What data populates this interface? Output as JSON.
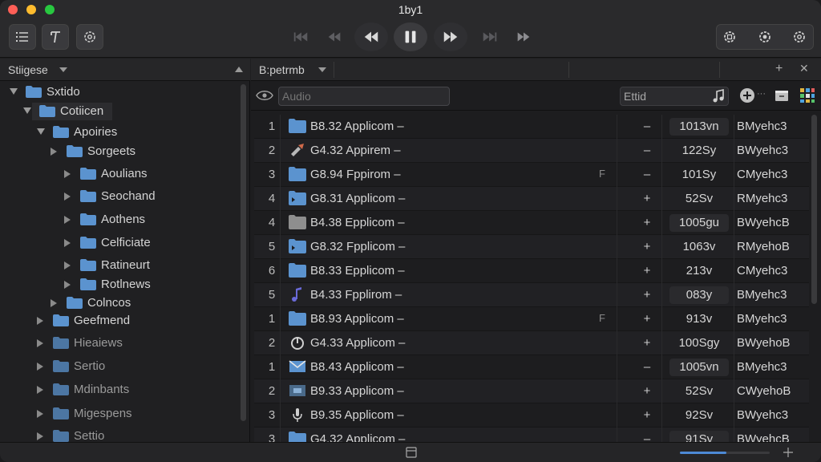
{
  "window": {
    "title": "1by1"
  },
  "toolbar": {
    "left_buttons": [
      "list-icon",
      "text-style-icon",
      "settings-icon"
    ],
    "media_buttons": [
      "skip-back-icon",
      "rewind-icon",
      "previous-icon",
      "pause-icon",
      "next-icon",
      "skip-forward-icon",
      "fast-forward-icon"
    ],
    "right_buttons": [
      "gear-icon",
      "gear-icon",
      "gear-icon"
    ]
  },
  "sidebar": {
    "title": "Stiigese",
    "tree": [
      {
        "label": "Sxtido",
        "depth": 0,
        "state": "open",
        "selected": false
      },
      {
        "label": "Cotiicen",
        "depth": 1,
        "state": "open",
        "selected": true
      },
      {
        "label": "Apoiries",
        "depth": 2,
        "state": "open",
        "selected": false
      },
      {
        "label": "Sorgeets",
        "depth": 3,
        "state": "closed",
        "selected": false
      },
      {
        "label": "Aoulians",
        "depth": 4,
        "state": "closed",
        "selected": false
      },
      {
        "label": "Seochand",
        "depth": 4,
        "state": "closed",
        "selected": false
      },
      {
        "label": "Aothens",
        "depth": 4,
        "state": "closed",
        "selected": false
      },
      {
        "label": "Celficiate",
        "depth": 4,
        "state": "closed",
        "selected": false
      },
      {
        "label": "Ratineurt",
        "depth": 4,
        "state": "closed",
        "selected": false
      },
      {
        "label": "Rotlnews",
        "depth": 4,
        "state": "closed",
        "selected": false
      },
      {
        "label": "Colncos",
        "depth": 3,
        "state": "closed",
        "selected": false
      },
      {
        "label": "Geefmend",
        "depth": 2,
        "state": "closed",
        "selected": false
      },
      {
        "label": "Hieaiews",
        "depth": 2,
        "state": "closed",
        "selected": false
      },
      {
        "label": "Sertio",
        "depth": 2,
        "state": "closed",
        "selected": false
      },
      {
        "label": "Mdinbants",
        "depth": 2,
        "state": "closed",
        "selected": false
      },
      {
        "label": "Migespens",
        "depth": 2,
        "state": "closed",
        "selected": false
      },
      {
        "label": "Settio",
        "depth": 2,
        "state": "closed",
        "selected": false
      }
    ]
  },
  "main": {
    "tab_label": "B:petrmb",
    "filter": {
      "value": "",
      "placeholder": "Audio",
      "kind_label": "Ettid"
    },
    "rows": [
      {
        "num": "1",
        "icon": "folder",
        "name": "B8.32 Applicom –",
        "flag": "",
        "sign": "–",
        "size": "1013vn",
        "size_boxed": true,
        "owner": "BMyehc3"
      },
      {
        "num": "2",
        "icon": "tool",
        "name": "G4.32 Appirem –",
        "flag": "",
        "sign": "–",
        "size": "122Sy",
        "size_boxed": false,
        "owner": "BWyehc3"
      },
      {
        "num": "3",
        "icon": "folder",
        "name": "G8.94 Fppirom –",
        "flag": "F",
        "sign": "–",
        "size": "101Sy",
        "size_boxed": false,
        "owner": "CMyehc3"
      },
      {
        "num": "4",
        "icon": "folder-alias",
        "name": "G8.31 Applicom –",
        "flag": "",
        "sign": "+",
        "size": "52Sv",
        "size_boxed": false,
        "owner": "RMyehc3"
      },
      {
        "num": "4",
        "icon": "folder-gray",
        "name": "B4.38 Epplicom –",
        "flag": "",
        "sign": "+",
        "size": "1005gu",
        "size_boxed": true,
        "owner": "BWyehcB"
      },
      {
        "num": "5",
        "icon": "folder-alias",
        "name": "G8.32 Fpplicom –",
        "flag": "",
        "sign": "+",
        "size": "1063v",
        "size_boxed": false,
        "owner": "RMyehoB"
      },
      {
        "num": "6",
        "icon": "folder",
        "name": "B8.33 Epplicom –",
        "flag": "",
        "sign": "+",
        "size": "213v",
        "size_boxed": false,
        "owner": "CMyehc3"
      },
      {
        "num": "5",
        "icon": "music",
        "name": "B4.33 Fpplirom –",
        "flag": "",
        "sign": "+",
        "size": "083y",
        "size_boxed": true,
        "owner": "BMyehc3"
      },
      {
        "num": "1",
        "icon": "folder",
        "name": "B8.93 Applicom –",
        "flag": "F",
        "sign": "+",
        "size": "913v",
        "size_boxed": false,
        "owner": "BMyehc3"
      },
      {
        "num": "2",
        "icon": "power",
        "name": "G4.33 Applicom –",
        "flag": "",
        "sign": "+",
        "size": "100Sgy",
        "size_boxed": false,
        "owner": "BWyehoB"
      },
      {
        "num": "1",
        "icon": "mail",
        "name": "B8.43 Applicom –",
        "flag": "",
        "sign": "–",
        "size": "1005vn",
        "size_boxed": true,
        "owner": "BMyehc3"
      },
      {
        "num": "2",
        "icon": "image",
        "name": "B9.33 Applicom –",
        "flag": "",
        "sign": "+",
        "size": "52Sv",
        "size_boxed": false,
        "owner": "CWyehoB"
      },
      {
        "num": "3",
        "icon": "mic",
        "name": "B9.35 Applicom –",
        "flag": "",
        "sign": "+",
        "size": "92Sv",
        "size_boxed": false,
        "owner": "BWyehc3"
      },
      {
        "num": "3",
        "icon": "folder",
        "name": "G4.32 Applicom –",
        "flag": "",
        "sign": "–",
        "size": "91Sy",
        "size_boxed": true,
        "owner": "BWyehcB"
      }
    ]
  },
  "statusbar": {
    "progress_fraction": 0.52
  },
  "colors": {
    "folder": "#5b93cf",
    "accent": "#4d8ad6",
    "close": "#ff5f57",
    "minimize": "#febc2e",
    "zoom": "#28c840"
  }
}
